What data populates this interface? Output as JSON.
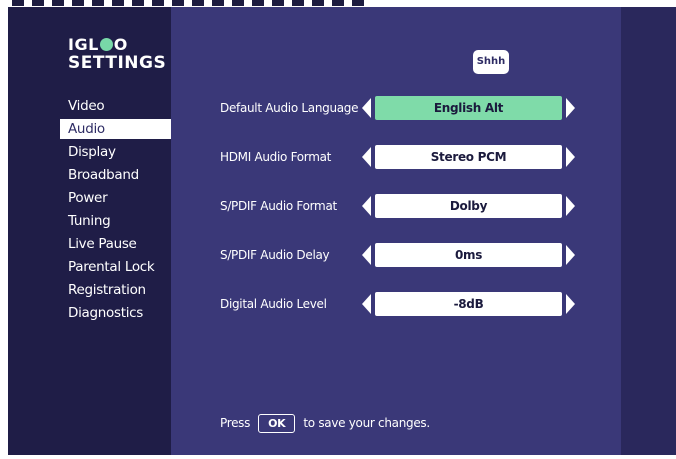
{
  "logo": {
    "line1_left": "IGL",
    "line1_right": "O",
    "line2": "SETTINGS"
  },
  "badge": {
    "text": "Shhh"
  },
  "menu": {
    "items": [
      {
        "label": "Video"
      },
      {
        "label": "Audio",
        "active": true
      },
      {
        "label": "Display"
      },
      {
        "label": "Broadband"
      },
      {
        "label": "Power"
      },
      {
        "label": "Tuning"
      },
      {
        "label": "Live Pause"
      },
      {
        "label": "Parental Lock"
      },
      {
        "label": "Registration"
      },
      {
        "label": "Diagnostics"
      }
    ]
  },
  "settings": [
    {
      "label": "Default Audio Language",
      "value": "English Alt",
      "selected": true
    },
    {
      "label": "HDMI Audio Format",
      "value": "Stereo PCM"
    },
    {
      "label": "S/PDIF Audio Format",
      "value": "Dolby"
    },
    {
      "label": "S/PDIF Audio Delay",
      "value": "0ms"
    },
    {
      "label": "Digital Audio Level",
      "value": "-8dB"
    }
  ],
  "footer": {
    "press": "Press",
    "ok": "OK",
    "suffix": "to save your changes."
  },
  "colors": {
    "background": "#2e2c64",
    "panel": "#3a3878",
    "highlight": "#7fdba9",
    "accent_dot": "#78d8a8"
  }
}
